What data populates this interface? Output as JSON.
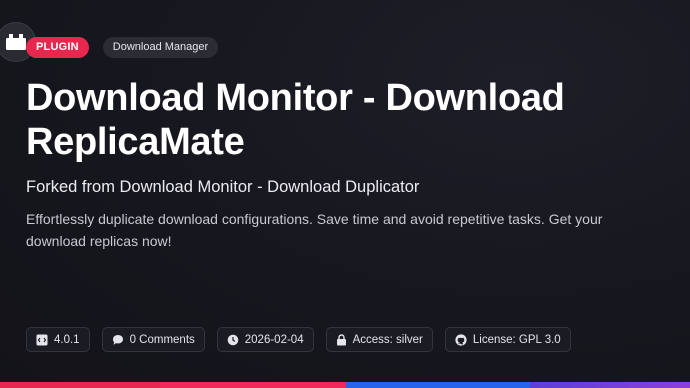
{
  "header": {
    "type_badge": "PLUGIN",
    "category": "Download Manager"
  },
  "title": "Download Monitor - Download ReplicaMate",
  "subtitle": "Forked from Download Monitor - Download Duplicator",
  "description": "Effortlessly duplicate download configurations. Save time and avoid repetitive tasks. Get your download replicas now!",
  "meta": {
    "version": "4.0.1",
    "comments": "0 Comments",
    "date": "2026-02-04",
    "access": "Access: silver",
    "license": "License: GPL 3.0"
  },
  "icons": {
    "logo": "plugin-logo-icon",
    "version": "code-file-icon",
    "comments": "speech-bubble-icon",
    "date": "clock-icon",
    "access": "lock-icon",
    "license": "github-icon"
  },
  "colors": {
    "accent": "#e8274f",
    "background": "#15151d",
    "bar": [
      "#e8274f",
      "#e8274f",
      "#2563eb",
      "#7c3aed"
    ]
  }
}
